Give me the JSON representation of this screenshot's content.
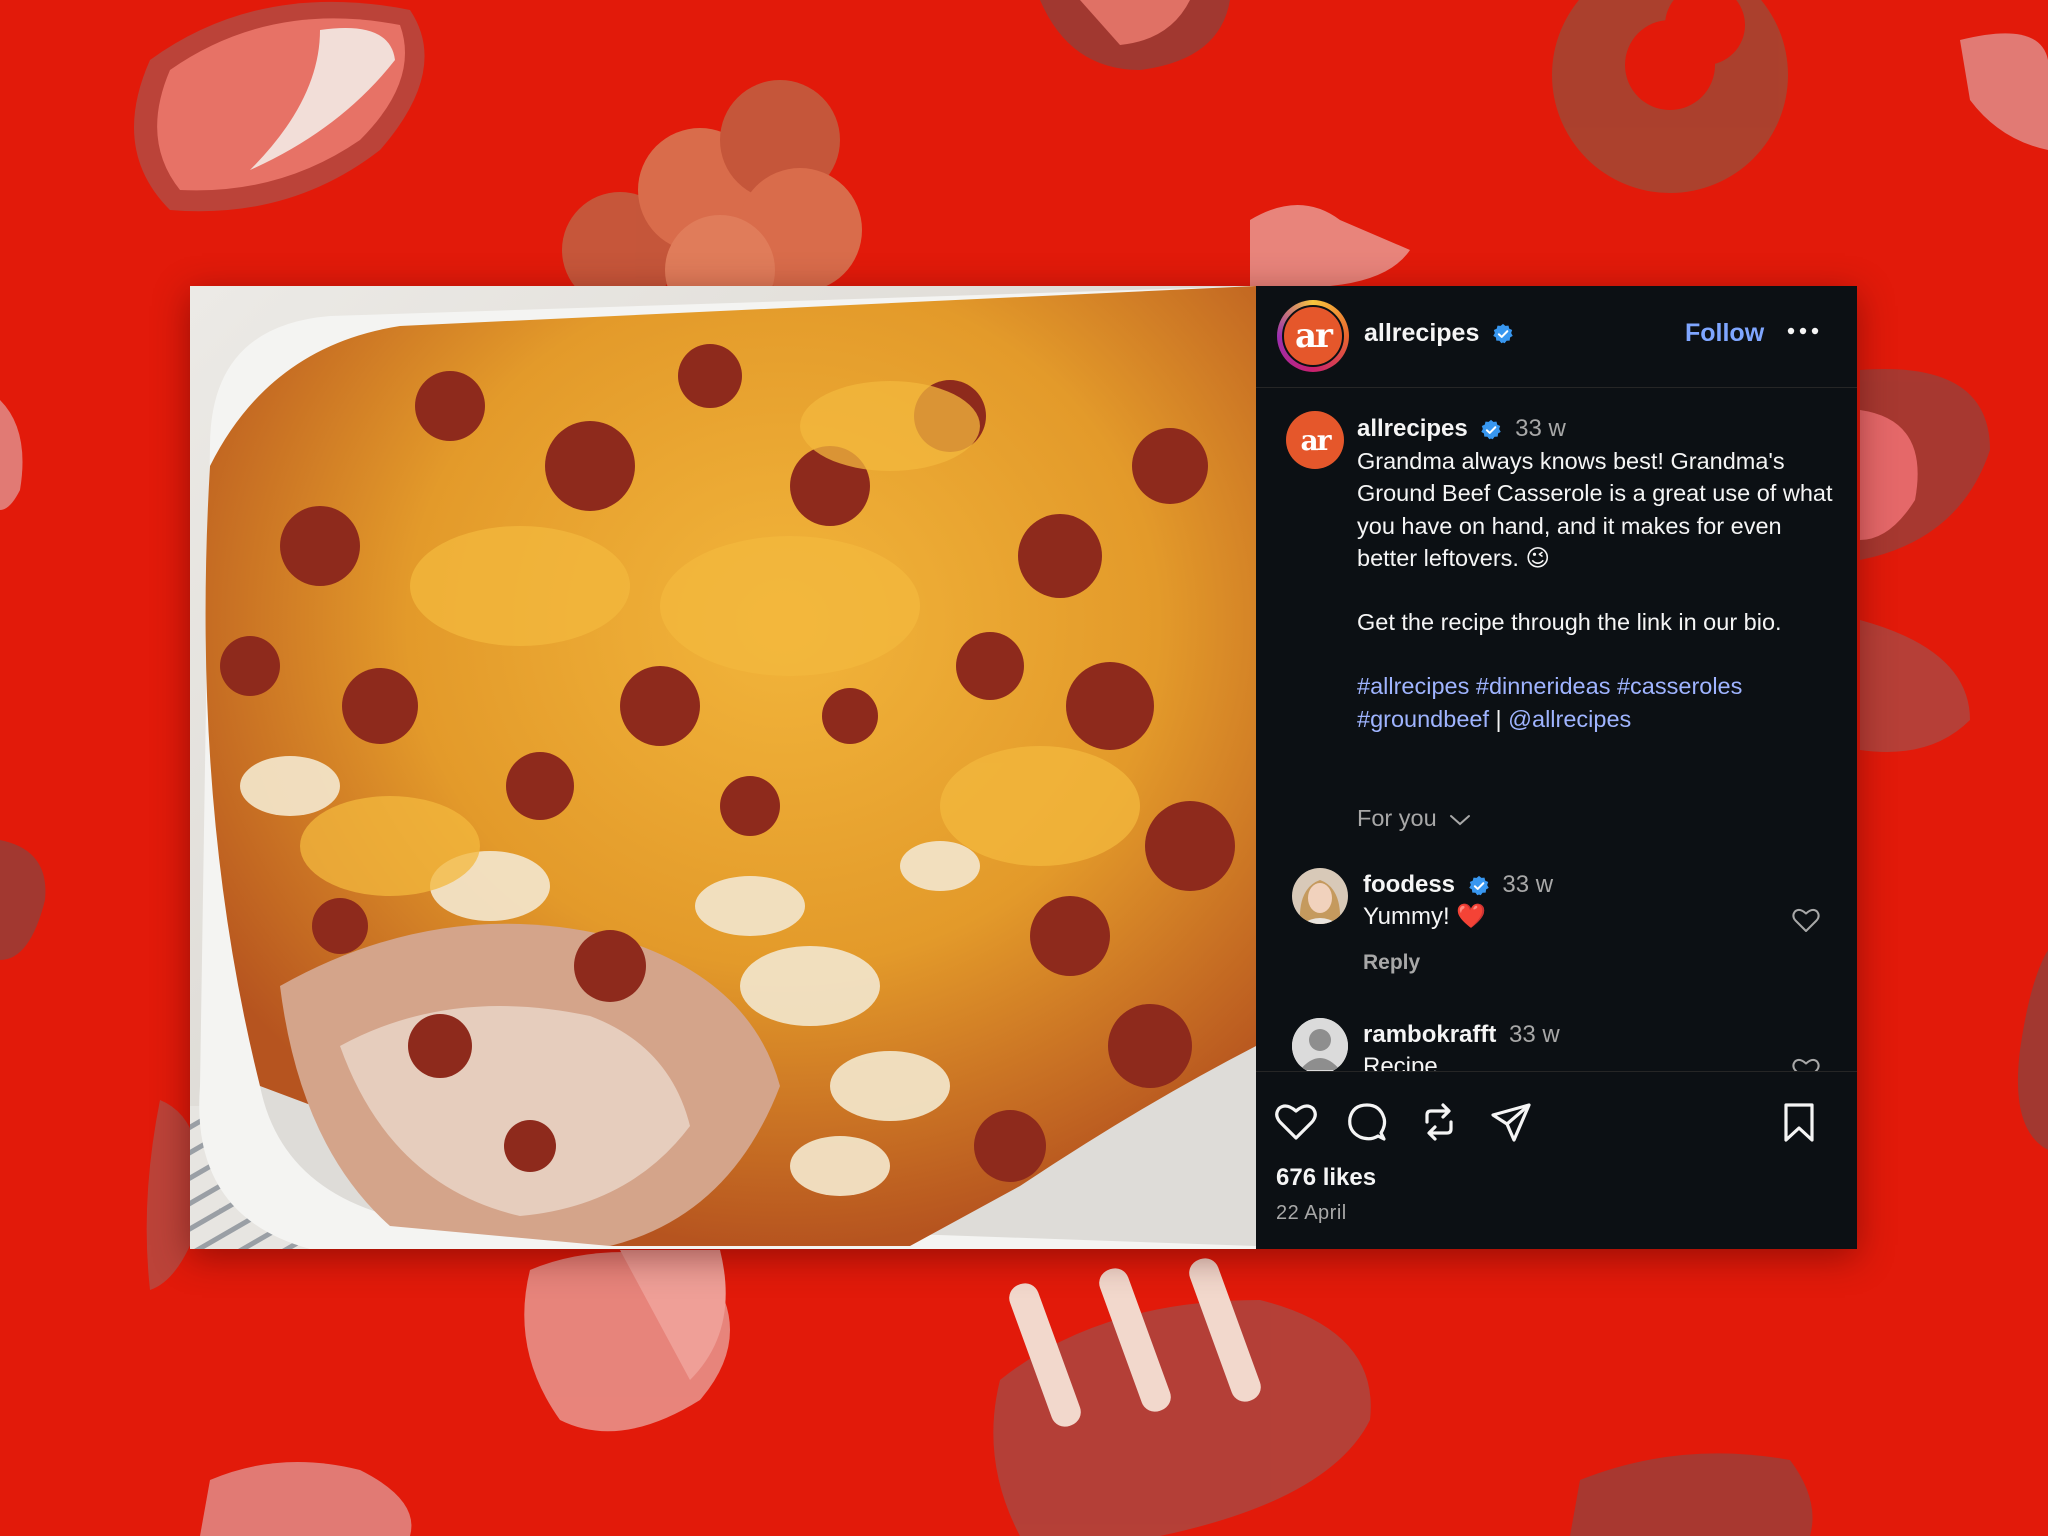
{
  "post": {
    "header": {
      "username": "allrecipes",
      "avatar_text": "ar",
      "follow_label": "Follow"
    },
    "caption": {
      "username": "allrecipes",
      "avatar_text": "ar",
      "time": "33 w",
      "paragraph_1": "Grandma always knows best! Grandma's Ground Beef Casserole is a great use of what you have on hand, and it makes for even better leftovers. 😉",
      "paragraph_2": "Get the recipe through the link in our bio.",
      "hashtags": [
        "#allrecipes",
        "#dinnerideas",
        "#casseroles",
        "#groundbeef"
      ],
      "separator": "|",
      "mention": "@allrecipes"
    },
    "for_you_label": "For you",
    "comments": [
      {
        "username": "foodess",
        "verified": true,
        "time": "33 w",
        "text": "Yummy! ❤️",
        "reply_label": "Reply"
      },
      {
        "username": "rambokrafft",
        "verified": false,
        "time": "33 w",
        "text": "Recipe"
      }
    ],
    "likes": "676 likes",
    "date": "22 April"
  },
  "colors": {
    "background": "#e21a0a",
    "panel": "#0c1014",
    "link_blue": "#7fa6ff",
    "hashtag_blue": "#9fb4ff",
    "avatar_orange": "#e5572b"
  },
  "icons": [
    "like-icon",
    "comment-icon",
    "repost-icon",
    "share-icon",
    "save-icon",
    "more-icon",
    "verified-icon",
    "chevron-down-icon"
  ]
}
